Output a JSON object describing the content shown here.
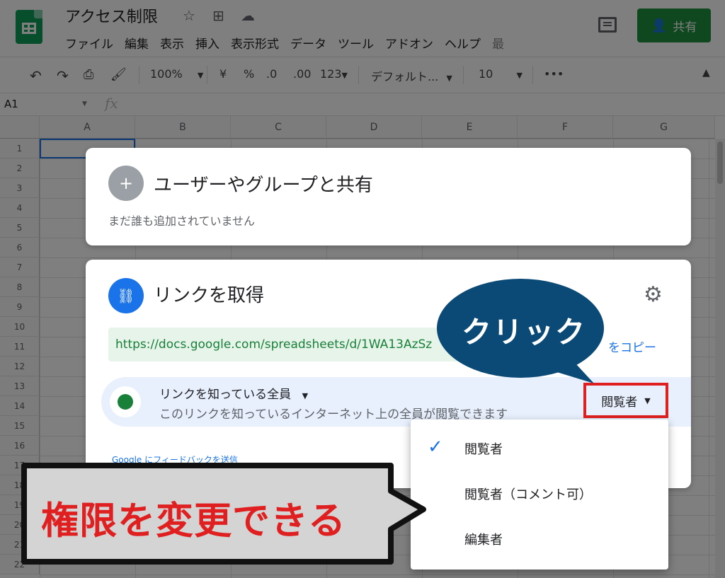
{
  "app": {
    "doc_title": "アクセス制限",
    "menu": [
      "ファイル",
      "編集",
      "表示",
      "挿入",
      "表示形式",
      "データ",
      "ツール",
      "アドオン",
      "ヘルプ",
      "最"
    ],
    "share_label": "共有"
  },
  "toolbar": {
    "zoom": "100%",
    "currency": "¥",
    "percent": "%",
    "dec_decrease": ".0",
    "dec_increase": ".00",
    "number_format": "123",
    "font": "デフォルト...",
    "font_size": "10",
    "more": "•••"
  },
  "formula_bar": {
    "cell_ref": "A1",
    "fx": "fx"
  },
  "sheet": {
    "columns": [
      "A",
      "B",
      "C",
      "D",
      "E",
      "F",
      "G"
    ],
    "rows": [
      "1",
      "2",
      "3",
      "4",
      "5",
      "6",
      "7",
      "8",
      "9",
      "10",
      "11",
      "12",
      "13",
      "14",
      "15",
      "16",
      "17",
      "18",
      "19",
      "20",
      "21",
      "22"
    ]
  },
  "share_dialog": {
    "people_title": "ユーザーやグループと共有",
    "people_subtitle": "まだ誰も追加されていません",
    "link_title": "リンクを取得",
    "link_url": "https://docs.google.com/spreadsheets/d/1WA13AzSz",
    "copy_link": "をコピー",
    "access_scope": "リンクを知っている全員",
    "access_description": "このリンクを知っているインターネット上の全員が閲覧できます",
    "role_current": "閲覧者",
    "feedback": "Google にフィードバックを送信"
  },
  "role_menu": {
    "items": [
      {
        "label": "閲覧者",
        "checked": true
      },
      {
        "label": "閲覧者（コメント可）",
        "checked": false
      },
      {
        "label": "編集者",
        "checked": false
      }
    ]
  },
  "annotations": {
    "click_bubble": "クリック",
    "callout": "権限を変更できる"
  },
  "colors": {
    "sheets_green": "#0f9d58",
    "share_button": "#1e8e3e",
    "link_blue": "#1a73e8",
    "highlight_red": "#e02020",
    "bubble_navy": "#0b4a76"
  }
}
